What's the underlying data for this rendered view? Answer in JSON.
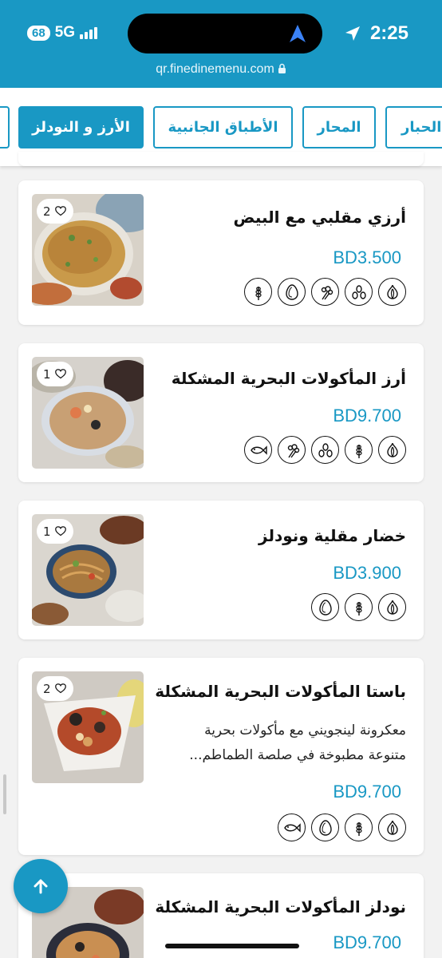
{
  "status_bar": {
    "battery": "68",
    "network": "5G",
    "time": "2:25",
    "url": "qr.finedinemenu.com",
    "bg_color": "#1998c4"
  },
  "tabs": [
    {
      "label": "الحبار",
      "active": false
    },
    {
      "label": "المحار",
      "active": false
    },
    {
      "label": "الأطباق الجانبية",
      "active": false
    },
    {
      "label": "الأرز و النودلز",
      "active": true
    }
  ],
  "items": [
    {
      "title": "أرزي مقلبي مع البيض",
      "description": "",
      "price": "BD3.500",
      "likes": "2",
      "allergens": [
        "garlic-icon",
        "seeds-icon",
        "celery-icon",
        "egg-icon",
        "wheat-icon"
      ]
    },
    {
      "title": "أرز المأكولات البحرية المشكلة",
      "description": "",
      "price": "BD9.700",
      "likes": "1",
      "allergens": [
        "garlic-icon",
        "wheat-icon",
        "seeds-icon",
        "celery-icon",
        "fish-icon"
      ]
    },
    {
      "title": "خضار مقلية ونودلز",
      "description": "",
      "price": "BD3.900",
      "likes": "1",
      "allergens": [
        "garlic-icon",
        "wheat-icon",
        "egg-icon"
      ]
    },
    {
      "title": "باستا المأكولات البحرية المشكلة",
      "description": "معكرونة لينجويني مع مأكولات بحرية متنوعة مطبوخة في صلصة الطماطم...",
      "price": "BD9.700",
      "likes": "2",
      "allergens": [
        "garlic-icon",
        "wheat-icon",
        "egg-icon",
        "fish-icon"
      ]
    },
    {
      "title": "نودلز المأكولات البحرية المشكلة",
      "description": "",
      "price": "BD9.700",
      "likes": "",
      "allergens": []
    }
  ],
  "accent_color": "#1998c4"
}
